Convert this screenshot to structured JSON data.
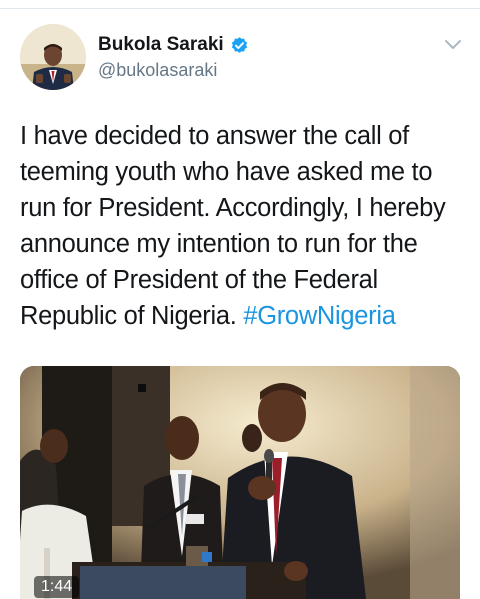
{
  "tweet": {
    "author": {
      "display_name": "Bukola Saraki",
      "handle": "@bukolasaraki",
      "verified": true
    },
    "text_lines": [
      "I have decided to answer the call of",
      "teeming youth who have asked me to",
      "run for President. Accordingly, I hereby",
      "announce my intention to run for the",
      "office of President of the Federal",
      "Republic of Nigeria."
    ],
    "hashtag": "#GrowNigeria",
    "media": {
      "type": "video",
      "duration": "1:44"
    }
  },
  "colors": {
    "text": "#14171a",
    "secondary": "#657786",
    "link": "#1b95e0",
    "verified": "#1da1f2"
  },
  "icons": {
    "verified": "verified-badge-icon",
    "menu": "chevron-down-icon"
  }
}
